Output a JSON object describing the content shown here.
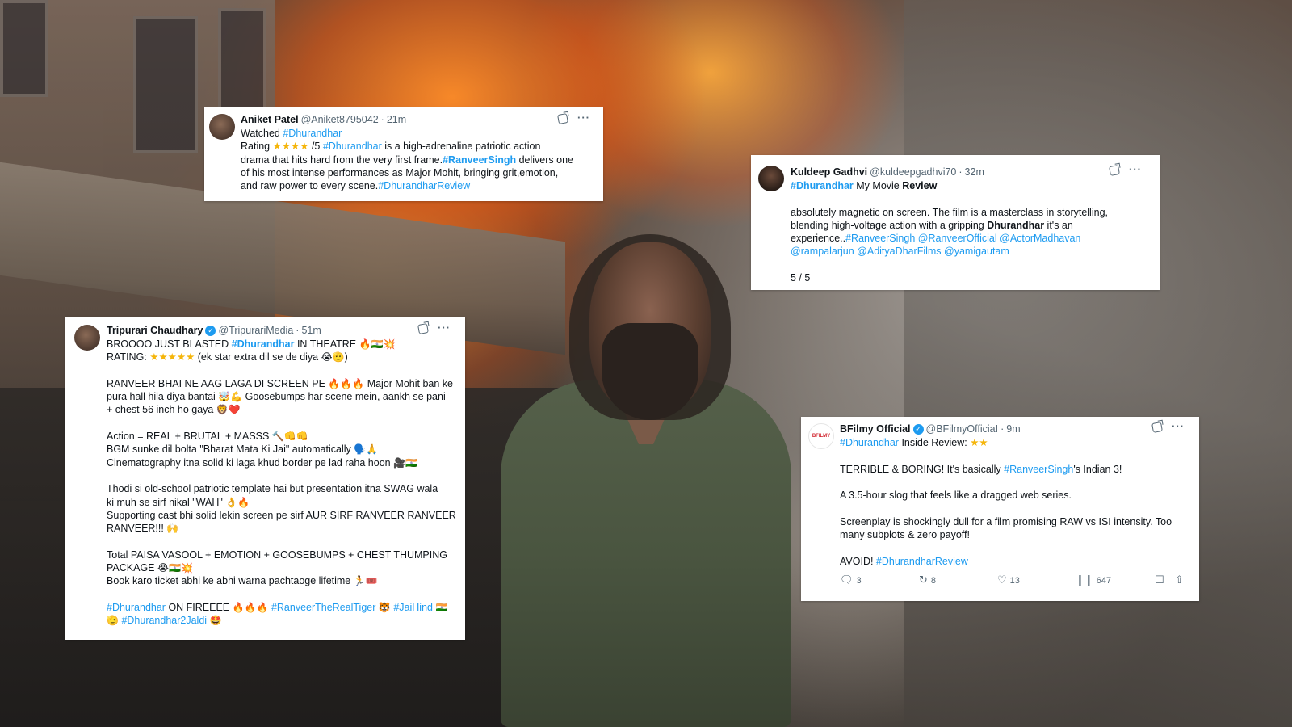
{
  "tweets": [
    {
      "name": "Aniket Patel",
      "handle": "@Aniket8795042",
      "time": "21m",
      "lines": {
        "l1_text": "Watched ",
        "l1_tag": "#Dhurandhar",
        "l2_a": "Rating ",
        "l2_stars": "★★★★",
        "l2_b": " /5 ",
        "l2_tag": "#Dhurandhar",
        "l2_c": " is a high-adrenaline patriotic action",
        "l3_a": "drama that hits hard from the very first frame.",
        "l3_tag": "#RanveerSingh",
        "l3_b": " delivers one",
        "l4": "of his most intense performances as Major Mohit, bringing grit,emotion,",
        "l5_a": "and raw power to every scene.",
        "l5_tag": "#DhurandharReview"
      }
    },
    {
      "name": "Kuldeep Gadhvi",
      "handle": "@kuldeepgadhvi70",
      "time": "32m",
      "lines": {
        "l1_tag": "#Dhurandhar",
        "l1_a": " My Movie ",
        "l1_bold": "Review",
        "l2": "absolutely magnetic on screen. The film is a masterclass in storytelling,",
        "l3_a": "blending high-voltage action with a gripping ",
        "l3_bold": "Dhurandhar",
        "l3_b": " it's an",
        "l4_a": "experience..",
        "l4_tags": "#RanveerSingh @RanveerOfficial @ActorMadhavan",
        "l5_tags": "@rampalarjun @AdityaDharFilms @yamigautam",
        "l6": "5 / 5"
      }
    },
    {
      "name": "Tripurari Chaudhary",
      "handle": "@TripurariMedia",
      "time": "51m",
      "lines": {
        "l1_a": "BROOOO JUST BLASTED ",
        "l1_tag": "#Dhurandhar",
        "l1_b": " IN THEATRE ",
        "l1_emo": "🔥🇮🇳💥",
        "l2_a": "RATING: ",
        "l2_stars": "★★★★★",
        "l2_b": " (ek star extra dil se de diya ",
        "l2_emo": "😭🫡",
        "l2_c": ")",
        "l3_a": "RANVEER BHAI NE AAG LAGA DI SCREEN PE ",
        "l3_emo": "🔥🔥🔥",
        "l3_b": " Major Mohit ban ke",
        "l4_a": "pura hall hila diya bantai ",
        "l4_emo": "🤯💪",
        "l4_b": " Goosebumps har scene mein, aankh se pani",
        "l5_a": "+ chest 56 inch ho gaya ",
        "l5_emo": "🦁❤️",
        "l6_a": "Action = REAL + BRUTAL + MASSS ",
        "l6_emo": "🔨👊👊",
        "l7_a": "BGM sunke dil bolta \"Bharat Mata Ki Jai\" automatically ",
        "l7_emo": "🗣️🙏",
        "l8_a": "Cinematography itna solid ki laga khud border pe lad raha hoon ",
        "l8_emo": "🎥🇮🇳",
        "l9": "Thodi si old-school patriotic template hai but presentation itna SWAG wala",
        "l10_a": "ki muh se sirf nikal \"WAH\" ",
        "l10_emo": "👌🔥",
        "l11": "Supporting cast bhi solid lekin screen pe sirf AUR SIRF RANVEER RANVEER",
        "l12_a": "RANVEER!!! ",
        "l12_emo": "🙌",
        "l13": "Total PAISA VASOOL + EMOTION + GOOSEBUMPS + CHEST THUMPING",
        "l14_a": "PACKAGE ",
        "l14_emo": "😭🇮🇳💥",
        "l15_a": "Book karo ticket abhi ke abhi warna pachtaoge lifetime ",
        "l15_emo": "🏃🎟️",
        "l16_tag1": "#Dhurandhar",
        "l16_a": " ON FIREEEE ",
        "l16_emo1": "🔥🔥🔥",
        "l16_tag2": "#RanveerTheRealTiger",
        "l16_emo2": "🐯",
        "l16_tag3": "#JaiHind",
        "l16_emo3": "🇮🇳",
        "l17_emo": "🫡",
        "l17_tag": "#Dhurandhar2Jaldi",
        "l17_emo2": "🤩"
      }
    },
    {
      "name": "BFilmy Official",
      "handle": "@BFilmyOfficiaI",
      "time": "9m",
      "lines": {
        "l1_tag": "#Dhurandhar",
        "l1_a": " Inside Review: ",
        "l1_stars": "★★",
        "l2_a": "TERRIBLE & BORING! It's basically ",
        "l2_tag": "#RanveerSingh",
        "l2_b": "'s Indian 3!",
        "l3": "A 3.5-hour slog that feels like a dragged web series.",
        "l4": "Screenplay is shockingly dull for a film promising RAW vs ISI intensity. Too",
        "l5": "many subplots & zero payoff!",
        "l6_a": "AVOID! ",
        "l6_tag": "#DhurandharReview"
      },
      "stats": {
        "replies": "3",
        "reposts": "8",
        "likes": "13",
        "views": "647"
      },
      "avatar_label": "BFILMY"
    }
  ],
  "ui": {
    "dot": "·",
    "more": "···",
    "verified": "✓"
  },
  "colors": {
    "link": "#1d9bf0",
    "text": "#0f1419",
    "muted": "#536471",
    "star": "#f5b50a"
  }
}
